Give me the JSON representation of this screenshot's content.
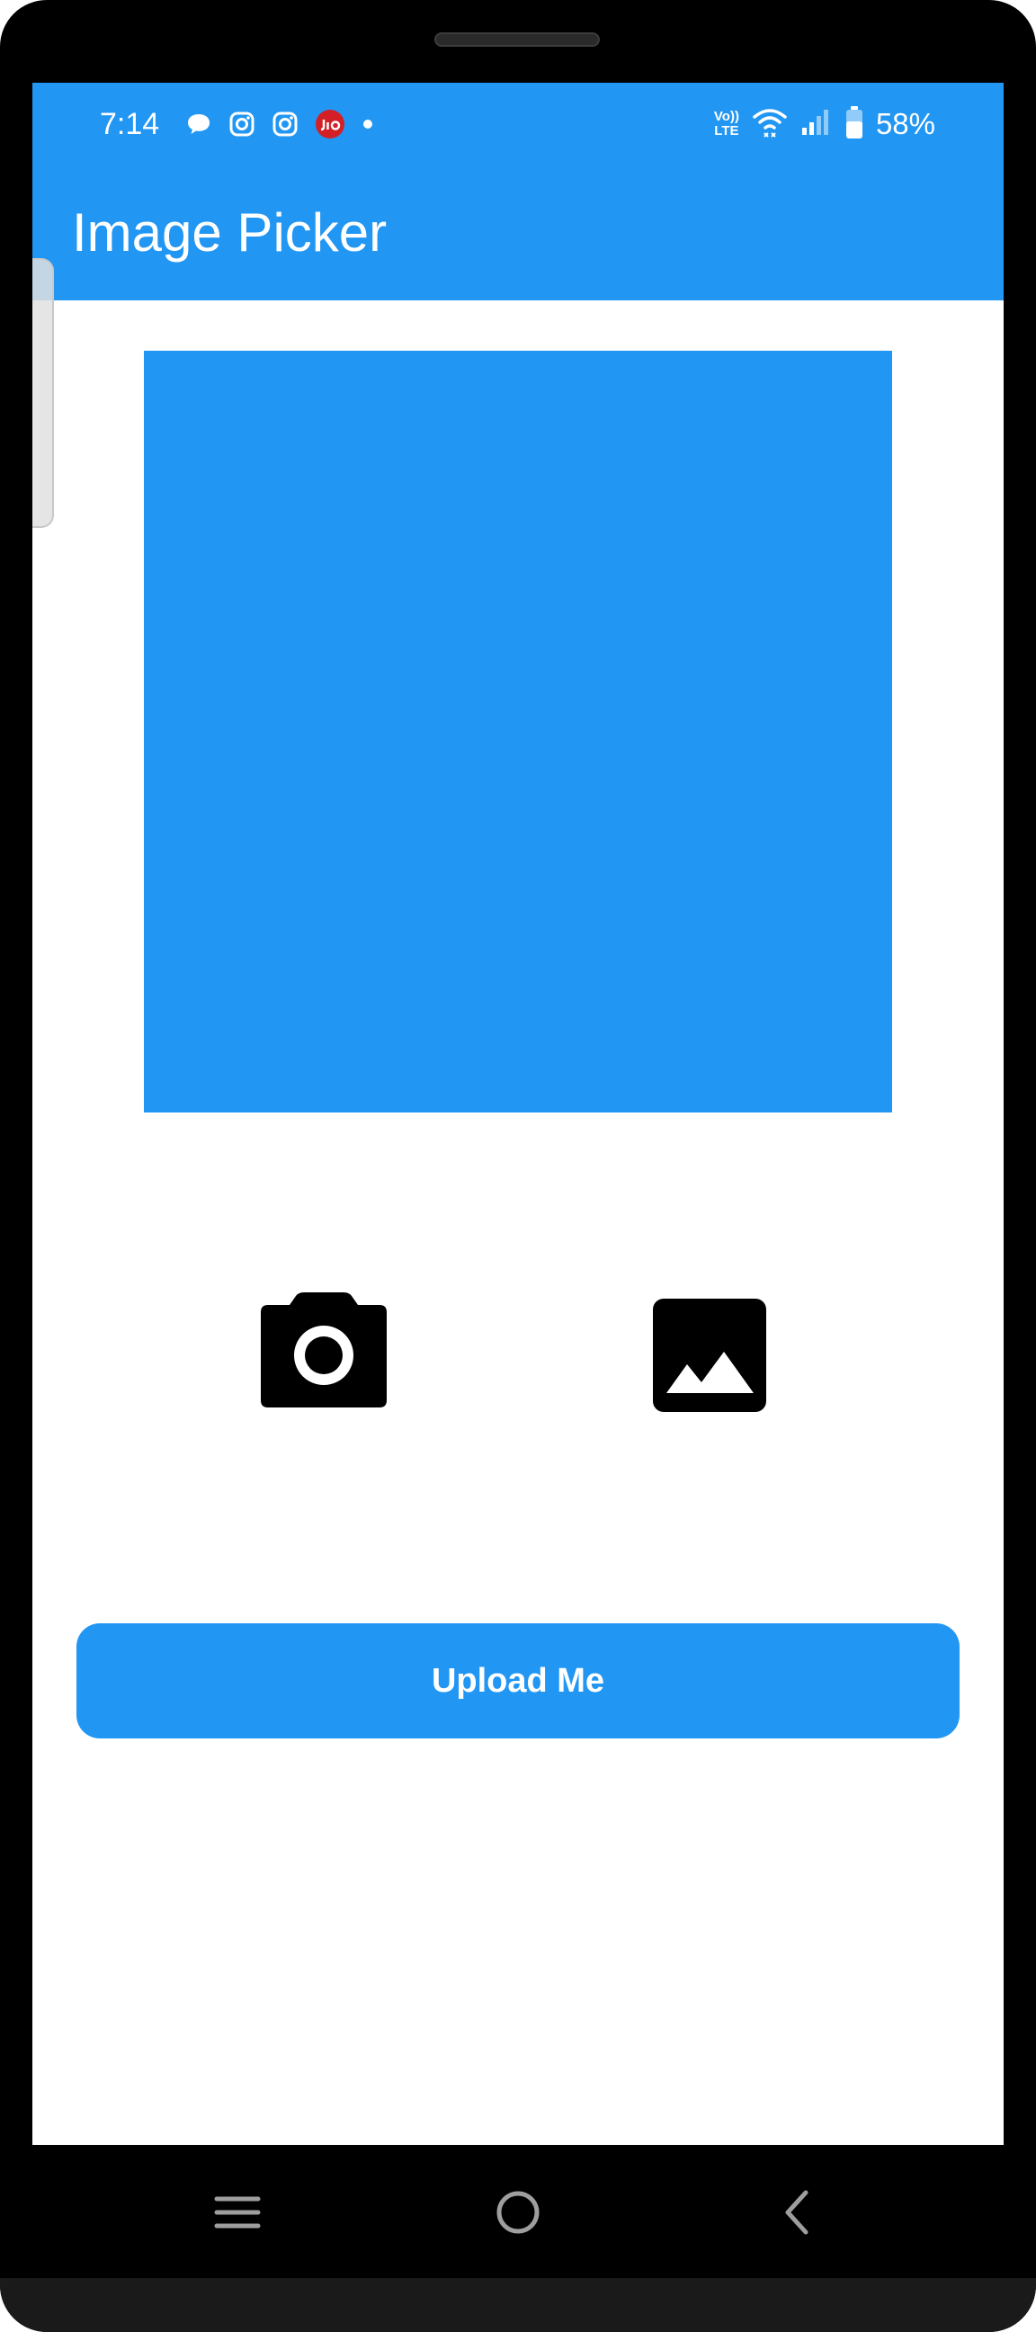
{
  "status_bar": {
    "time": "7:14",
    "left_icons": [
      "chat-bubble-icon",
      "instagram-icon",
      "instagram-icon",
      "jio-icon",
      "dot-icon"
    ],
    "volte_top": "Vo))",
    "volte_bottom": "LTE",
    "battery_percent": "58%",
    "colors": {
      "background": "#2196F3",
      "foreground": "#FFFFFF"
    }
  },
  "app_bar": {
    "title": "Image Picker",
    "color": "#2196F3"
  },
  "preview": {
    "color": "#2196F3"
  },
  "actions": {
    "camera_icon": "camera-icon",
    "gallery_icon": "image-gallery-icon"
  },
  "upload_button": {
    "label": "Upload Me",
    "color": "#2196F3"
  },
  "navigation_bar": {
    "buttons": [
      "recent-apps-icon",
      "home-icon",
      "back-icon"
    ]
  }
}
